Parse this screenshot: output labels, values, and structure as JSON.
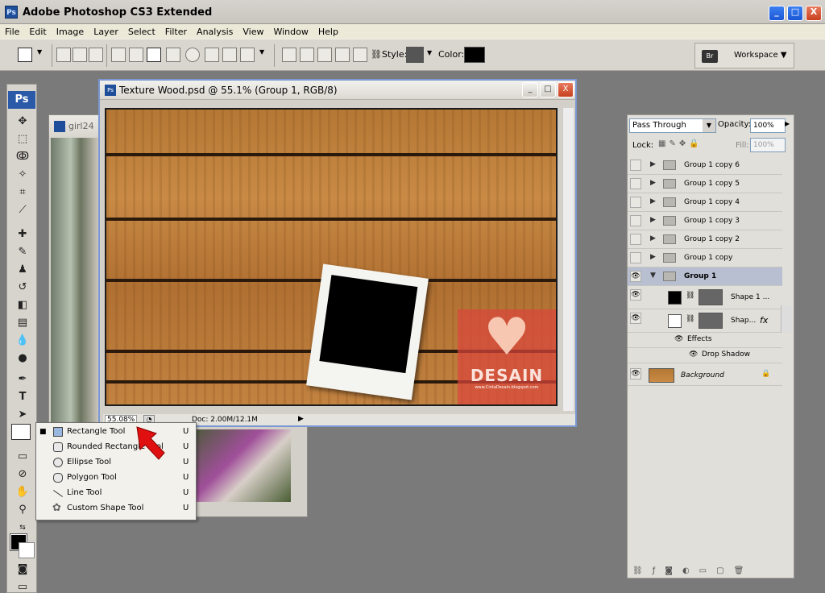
{
  "app": {
    "title": "Adobe Photoshop CS3 Extended",
    "logo_text": "Ps",
    "window_buttons": {
      "minimize": "_",
      "maximize": "□",
      "close": "X"
    }
  },
  "menu": [
    "File",
    "Edit",
    "Image",
    "Layer",
    "Select",
    "Filter",
    "Analysis",
    "View",
    "Window",
    "Help"
  ],
  "options_bar": {
    "style_label": "Style:",
    "color_label": "Color:",
    "workspace_label": "Workspace ▼",
    "workspace_icon": "Br",
    "color_value": "#000000",
    "style_swatch": "#555555"
  },
  "toolbox": {
    "header": "Ps"
  },
  "back_document": {
    "title": "girl24"
  },
  "document": {
    "title": "Texture Wood.psd @ 55.1% (Group 1, RGB/8)",
    "zoom": "55.08%",
    "doc_info": "Doc: 2.00M/12.1M",
    "watermark_brand": "DESAIN",
    "watermark_site": "www.CintaDesain.blogspot.com"
  },
  "flyout": {
    "items": [
      {
        "label": "Rectangle Tool",
        "key": "U",
        "selected": true,
        "bullet": "■"
      },
      {
        "label": "Rounded Rectangle Tool",
        "key": "U",
        "selected": false,
        "bullet": ""
      },
      {
        "label": "Ellipse Tool",
        "key": "U",
        "selected": false,
        "bullet": ""
      },
      {
        "label": "Polygon Tool",
        "key": "U",
        "selected": false,
        "bullet": ""
      },
      {
        "label": "Line Tool",
        "key": "U",
        "selected": false,
        "bullet": ""
      },
      {
        "label": "Custom Shape Tool",
        "key": "U",
        "selected": false,
        "bullet": ""
      }
    ]
  },
  "layers_panel": {
    "blend_mode": "Pass Through",
    "opacity_label": "Opacity:",
    "opacity_value": "100%",
    "lock_label": "Lock:",
    "fill_label": "Fill:",
    "fill_value": "100%",
    "layers": [
      {
        "name": "Group 1 copy 6"
      },
      {
        "name": "Group 1 copy 5"
      },
      {
        "name": "Group 1 copy 4"
      },
      {
        "name": "Group 1 copy 3"
      },
      {
        "name": "Group 1 copy 2"
      },
      {
        "name": "Group 1 copy"
      },
      {
        "name": "Group 1"
      },
      {
        "name": "Shape 1 ..."
      },
      {
        "name": "Shap..."
      },
      {
        "name": "Effects"
      },
      {
        "name": "Drop Shadow"
      },
      {
        "name": "Background"
      }
    ]
  }
}
